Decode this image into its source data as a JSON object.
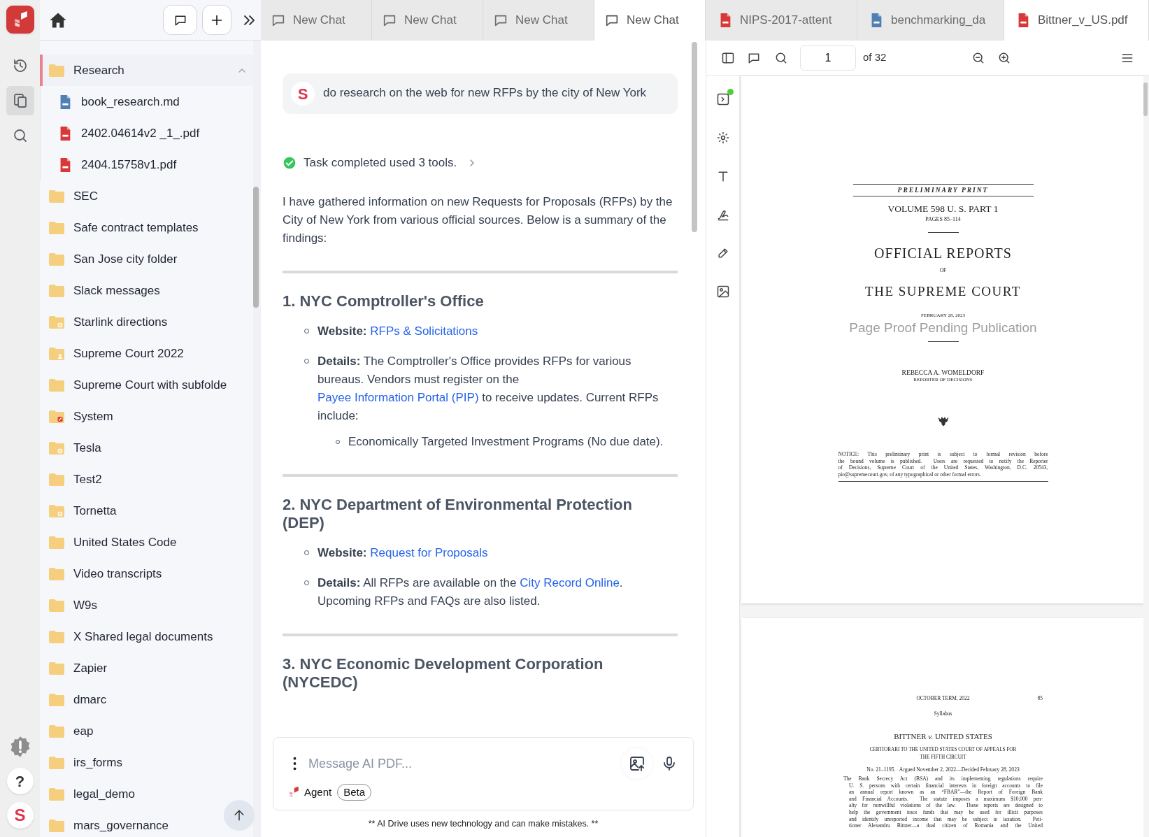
{
  "rail": {
    "items": [
      {
        "kind": "history",
        "selected": false
      },
      {
        "kind": "files",
        "selected": true
      },
      {
        "kind": "search",
        "selected": false
      }
    ],
    "help": "?",
    "avatar": "S"
  },
  "sidebar": {
    "tree": [
      {
        "label": "Research",
        "kind": "folder",
        "selected": true,
        "expanded": true,
        "children": [
          {
            "label": "book_research.md",
            "kind": "md",
            "selected": false
          },
          {
            "label": "2402.04614v2 _1_.pdf",
            "kind": "pdf",
            "selected": false
          },
          {
            "label": "2404.15758v1.pdf",
            "kind": "pdf",
            "selected": false
          }
        ]
      },
      {
        "label": "SEC",
        "kind": "folder",
        "selected": false
      },
      {
        "label": "Safe contract templates",
        "kind": "folder",
        "selected": false
      },
      {
        "label": "San Jose city folder",
        "kind": "folder",
        "selected": false
      },
      {
        "label": "Slack messages",
        "kind": "folder",
        "selected": false
      },
      {
        "label": "Starlink directions",
        "kind": "globe-folder",
        "selected": false
      },
      {
        "label": "Supreme Court 2022",
        "kind": "person-folder",
        "selected": false
      },
      {
        "label": "Supreme Court with subfolde",
        "kind": "folder",
        "selected": false
      },
      {
        "label": "System",
        "kind": "app-folder",
        "selected": false
      },
      {
        "label": "Tesla",
        "kind": "globe-folder",
        "selected": false
      },
      {
        "label": "Test2",
        "kind": "folder",
        "selected": false
      },
      {
        "label": "Tornetta",
        "kind": "globe-folder",
        "selected": false
      },
      {
        "label": "United States Code",
        "kind": "folder",
        "selected": false
      },
      {
        "label": "Video transcripts",
        "kind": "folder",
        "selected": false
      },
      {
        "label": "W9s",
        "kind": "folder",
        "selected": false
      },
      {
        "label": "X Shared legal documents",
        "kind": "folder",
        "selected": false
      },
      {
        "label": "Zapier",
        "kind": "folder",
        "selected": false
      },
      {
        "label": "dmarc",
        "kind": "folder",
        "selected": false
      },
      {
        "label": "eap",
        "kind": "folder",
        "selected": false
      },
      {
        "label": "irs_forms",
        "kind": "folder",
        "selected": false
      },
      {
        "label": "legal_demo",
        "kind": "folder",
        "selected": false
      },
      {
        "label": "mars_governance",
        "kind": "folder",
        "selected": false
      }
    ]
  },
  "chat_tabs": [
    {
      "label": "New Chat",
      "selected": false
    },
    {
      "label": "New Chat",
      "selected": false
    },
    {
      "label": "New Chat",
      "selected": false
    },
    {
      "label": "New Chat",
      "selected": true
    }
  ],
  "doc_tabs": [
    {
      "label": "NIPS-2017-attent",
      "kind": "pdf",
      "selected": false
    },
    {
      "label": "benchmarking_da",
      "kind": "md",
      "selected": false
    },
    {
      "label": "Bittner_v_US.pdf",
      "kind": "pdf",
      "selected": true
    }
  ],
  "chat": {
    "user_message": {
      "avatar": "S",
      "text": "do research on the web for new RFPs by the city of New York"
    },
    "task": {
      "text": "Task completed used 3 tools.",
      "completed": true
    },
    "intro": "I have gathered information on new Requests for Proposals (RFPs) by the City of New York from various official sources. Below is a summary of the findings:",
    "sections": [
      {
        "heading": "1. NYC Comptroller's Office",
        "bullets": [
          {
            "label": "Website:",
            "parts": [
              {
                "text": "RFPs & Solicitations",
                "link": true
              }
            ]
          },
          {
            "label": "Details:",
            "parts": [
              {
                "text": "The Comptroller's Office provides RFPs for various bureaus. Vendors must register on the ",
                "link": false
              },
              {
                "text": "Payee Information Portal (PIP)",
                "link": true
              },
              {
                "text": " to receive updates. Current RFPs include:",
                "link": false
              }
            ],
            "children": [
              "Economically Targeted Investment Programs (No due date)."
            ]
          }
        ]
      },
      {
        "heading": "2. NYC Department of Environmental Protection (DEP)",
        "bullets": [
          {
            "label": "Website:",
            "parts": [
              {
                "text": "Request for Proposals",
                "link": true
              }
            ]
          },
          {
            "label": "Details:",
            "parts": [
              {
                "text": "All RFPs are available on the ",
                "link": false
              },
              {
                "text": "City Record Online",
                "link": true
              },
              {
                "text": ". Upcoming RFPs and FAQs are also listed.",
                "link": false
              }
            ]
          }
        ]
      },
      {
        "heading": "3. NYC Economic Development Corporation (NYCEDC)"
      }
    ]
  },
  "composer": {
    "placeholder": "Message AI PDF...",
    "agent_label": "Agent",
    "badge": "Beta"
  },
  "disclaimer": "** AI Drive uses new technology and can make mistakes. **",
  "pdf": {
    "page_input": "1",
    "page_count": "of 32",
    "cover": {
      "banner": "PRELIMINARY PRINT",
      "volume": "VOLUME 598 U. S. PART 1",
      "pages": "PAGES 85–114",
      "title": "OFFICIAL REPORTS",
      "of": "OF",
      "court": "THE SUPREME COURT",
      "date": "FEBRUARY 28, 2023",
      "stamp": "Page Proof Pending Publication",
      "reporter": "REBECCA A. WOMELDORF",
      "reporter_title": "REPORTER OF DECISIONS",
      "notice": [
        "NOTICE: This preliminary print is subject to formal revision before",
        "the bound volume is published.  Users are requested to notify the Reporter",
        "of Decisions, Supreme Court of the United States, Washington, D.C. 20543,",
        "pio@supremecourt.gov, of any typographical or other formal errors."
      ]
    },
    "second": {
      "running_head": "OCTOBER TERM, 2022",
      "page_number": "85",
      "section": "Syllabus",
      "case": "BITTNER *v.* UNITED STATES",
      "certiorari": [
        "CERTIORARI TO THE UNITED STATES COURT OF APPEALS FOR",
        "THE FIFTH CIRCUIT"
      ],
      "docket": "No. 21–1195.   Argued November 2, 2022—Decided February 28, 2023",
      "paragraph": [
        "The Bank Secrecy Act (BSA) and its implementing regulations require",
        "U. S. persons with certain financial interests in foreign accounts to file",
        "an annual report known as an “FBAR”—the Report of Foreign Bank",
        "and Financial Accounts.  The statute imposes a maximum $10,000 pen-",
        "alty for nonwillful violations of the law.  These reports are designed to",
        "help the government trace funds that may be used for illicit purposes",
        "and identify unreported income that may be subject to taxation.  Peti-",
        "tioner Alexandru Bittner—a dual citizen of Romania and the United"
      ]
    }
  }
}
